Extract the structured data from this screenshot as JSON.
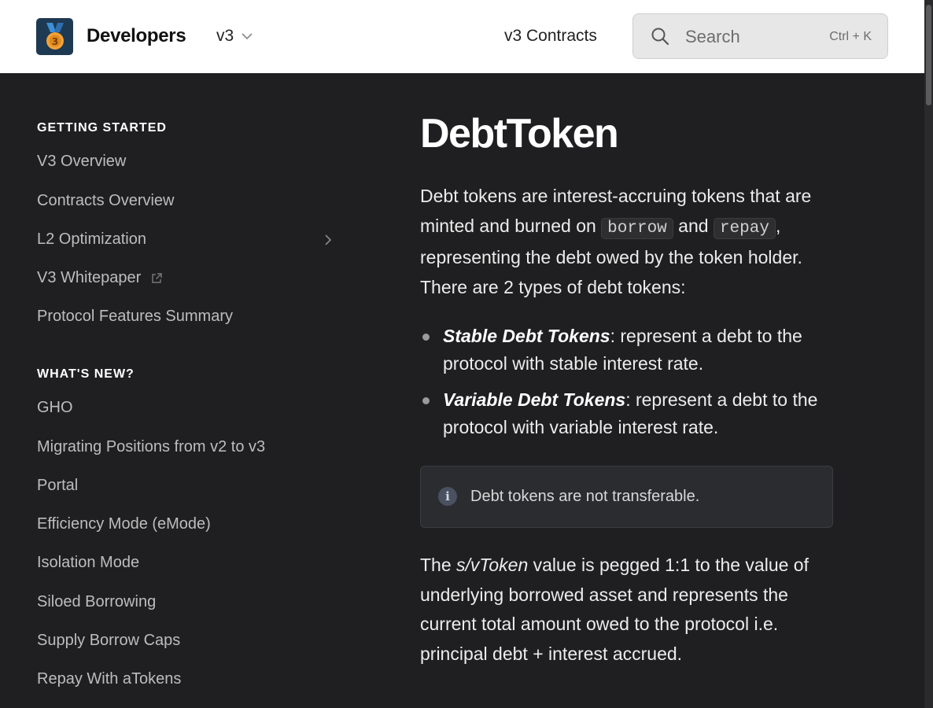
{
  "header": {
    "brand": "Developers",
    "version": "v3",
    "contracts_link": "v3 Contracts",
    "search_placeholder": "Search",
    "search_shortcut": "Ctrl + K"
  },
  "sidebar": {
    "sections": [
      {
        "title": "GETTING STARTED",
        "items": [
          {
            "label": "V3 Overview"
          },
          {
            "label": "Contracts Overview"
          },
          {
            "label": "L2 Optimization"
          },
          {
            "label": "V3 Whitepaper"
          },
          {
            "label": "Protocol Features Summary"
          }
        ]
      },
      {
        "title": "WHAT'S NEW?",
        "items": [
          {
            "label": "GHO"
          },
          {
            "label": "Migrating Positions from v2 to v3"
          },
          {
            "label": "Portal"
          },
          {
            "label": "Efficiency Mode (eMode)"
          },
          {
            "label": "Isolation Mode"
          },
          {
            "label": "Siloed Borrowing"
          },
          {
            "label": "Supply Borrow Caps"
          },
          {
            "label": "Repay With aTokens"
          }
        ]
      }
    ]
  },
  "page": {
    "title": "DebtToken",
    "intro": {
      "part1": "Debt tokens are interest-accruing tokens that are minted and burned on ",
      "code1": "borrow",
      "part2": " and ",
      "code2": "repay",
      "part3": ", representing the debt owed by the token holder. There are 2 types of debt tokens:"
    },
    "bullets": [
      {
        "term": "Stable Debt Tokens",
        "text": ": represent a debt to the protocol with stable interest rate."
      },
      {
        "term": "Variable Debt Tokens",
        "text": ": represent a debt to the protocol with variable interest rate."
      }
    ],
    "callout": "Debt tokens are not transferable.",
    "para2": {
      "part1": "The ",
      "emph": "s/vToken",
      "part2": " value is pegged 1:1 to the value of underlying borrowed asset and represents the current total amount owed to the protocol i.e. principal debt + interest accrued."
    }
  },
  "colors": {
    "background": "#1f1f21",
    "header": "#ffffff",
    "callout": "#2a2c30"
  }
}
